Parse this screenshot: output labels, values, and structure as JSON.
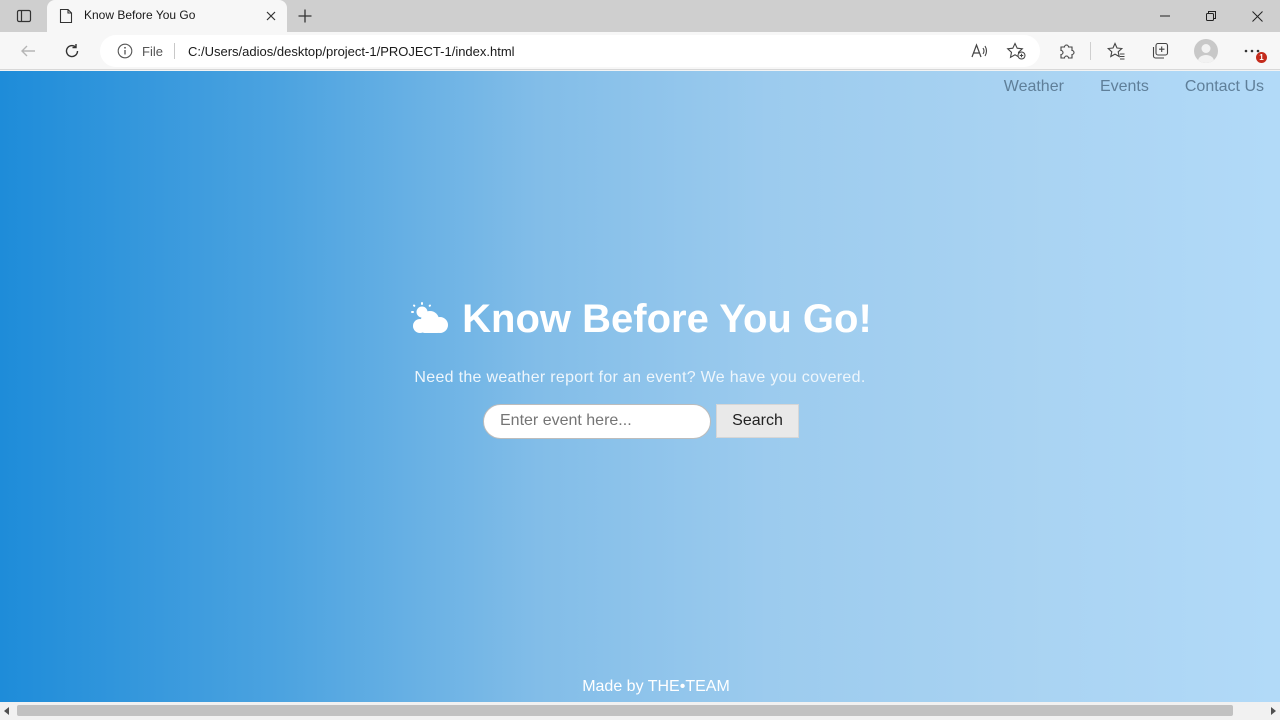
{
  "browser": {
    "tab": {
      "title": "Know Before You Go",
      "favicon": "page-icon"
    },
    "omnibox": {
      "scheme_label": "File",
      "url": "C:/Users/adios/desktop/project-1/PROJECT-1/index.html"
    },
    "notification_badge": "1"
  },
  "page": {
    "nav": [
      "Weather",
      "Events",
      "Contact Us"
    ],
    "hero": {
      "icon": "cloud-sun-icon",
      "title": "Know Before You Go!",
      "subtitle": "Need the weather report for an event? We have you covered."
    },
    "search": {
      "placeholder": "Enter event here...",
      "button_label": "Search"
    },
    "footer": "Made by THE•TEAM"
  },
  "colors": {
    "gradient_start": "#1e8cd9",
    "gradient_end": "#b2daf8",
    "nav_text": "#5f7f99"
  }
}
